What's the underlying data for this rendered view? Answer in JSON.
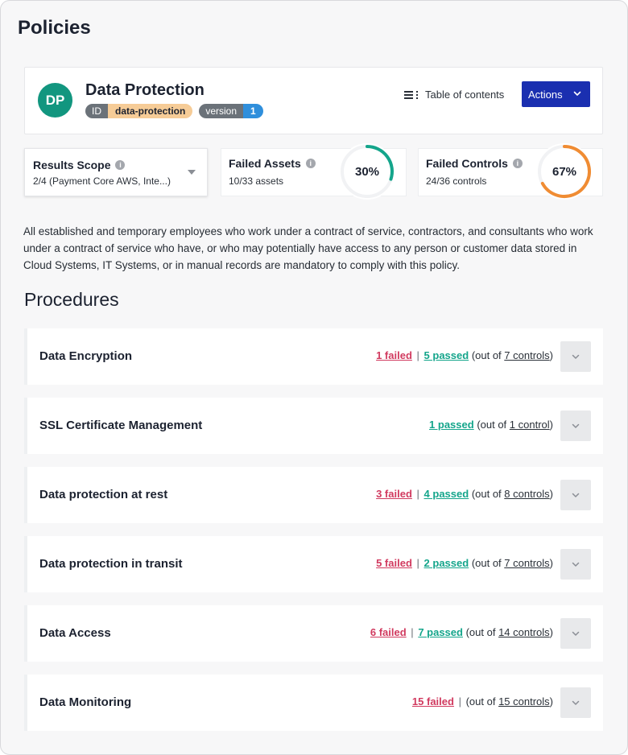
{
  "page": {
    "title": "Policies"
  },
  "policy": {
    "initials": "DP",
    "name": "Data Protection",
    "id_key": "ID",
    "id_value": "data-protection",
    "version_key": "version",
    "version_value": "1",
    "avatar_color": "#12967f"
  },
  "toolbar": {
    "toc_label": "Table of contents",
    "actions_label": "Actions"
  },
  "scope": {
    "title": "Results Scope",
    "value": "2/4 (Payment Core AWS, Inte...)"
  },
  "metrics": {
    "failed_assets": {
      "title": "Failed Assets",
      "sub": "10/33 assets",
      "percent_label": "30%",
      "fraction": 0.3,
      "color": "#14a58b"
    },
    "failed_controls": {
      "title": "Failed Controls",
      "sub": "24/36 controls",
      "percent_label": "67%",
      "fraction": 0.67,
      "color": "#f08c33"
    }
  },
  "description": "All established and temporary employees who work under a contract of service, contractors, and consultants who work under a contract of service who have, or who may potentially have access to any person or customer data stored in Cloud Systems, IT Systems, or in manual records are mandatory to comply with this policy.",
  "procedures_title": "Procedures",
  "procedures": [
    {
      "name": "Data Encryption",
      "failed": "1 failed",
      "passed": "5 passed",
      "out_prefix": "(out of ",
      "total": "7 controls",
      "out_suffix": ")"
    },
    {
      "name": "SSL Certificate Management",
      "failed": "",
      "passed": "1 passed",
      "out_prefix": "(out of ",
      "total": "1 control",
      "out_suffix": ")"
    },
    {
      "name": "Data protection at rest",
      "failed": "3 failed",
      "passed": "4 passed",
      "out_prefix": "(out of ",
      "total": "8 controls",
      "out_suffix": ")"
    },
    {
      "name": "Data protection in transit",
      "failed": "5 failed",
      "passed": "2 passed",
      "out_prefix": "(out of ",
      "total": "7 controls",
      "out_suffix": ")"
    },
    {
      "name": "Data Access",
      "failed": "6 failed",
      "passed": "7 passed",
      "out_prefix": "(out of ",
      "total": "14 controls",
      "out_suffix": ")"
    },
    {
      "name": "Data Monitoring",
      "failed": "15 failed",
      "passed": "",
      "out_prefix": "(out of ",
      "total": "15 controls",
      "out_suffix": ")"
    }
  ],
  "icons": {
    "info": "info-icon",
    "toc": "list-icon",
    "actions_chevron": "chevron-down-icon",
    "scope_caret": "caret-down-icon",
    "expand": "chevron-down-icon"
  }
}
